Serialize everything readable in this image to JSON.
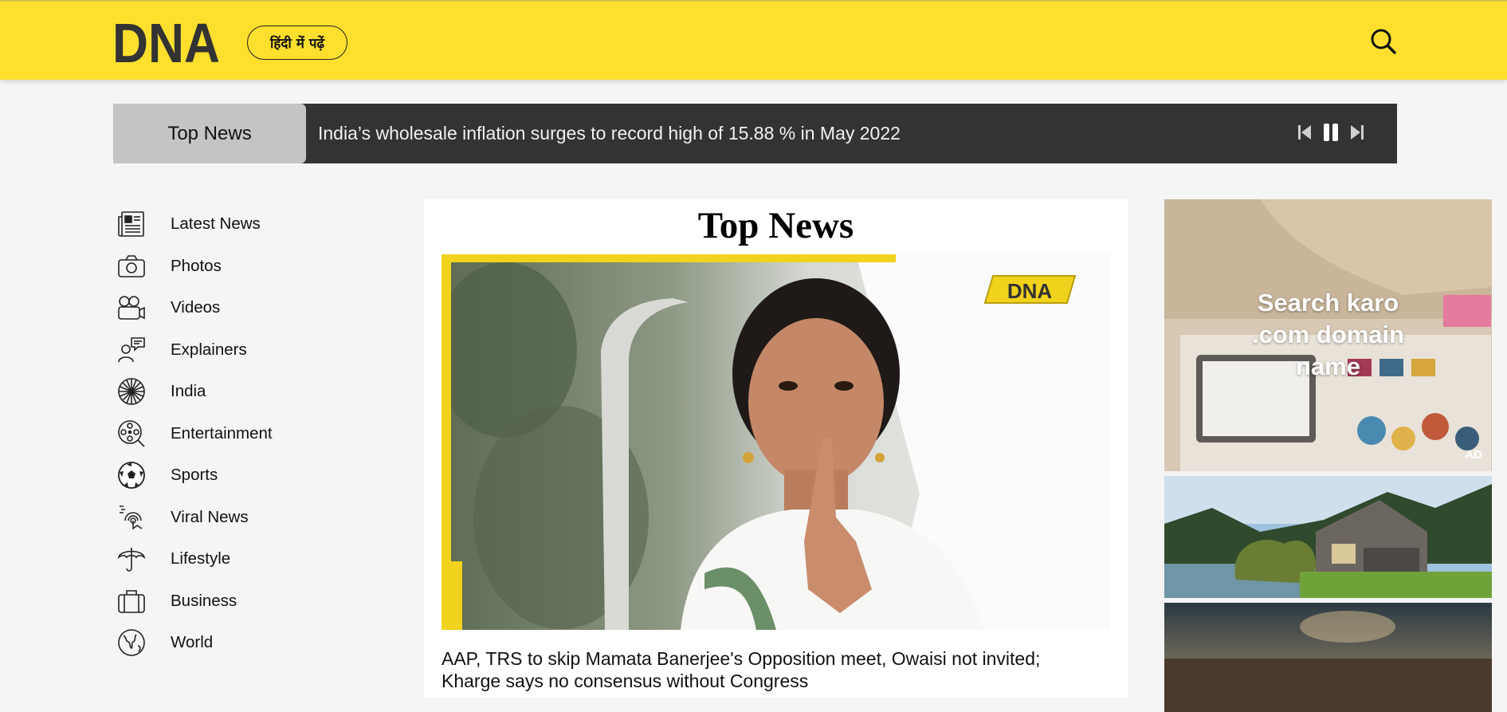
{
  "header": {
    "logo_text": "DNA",
    "language_button": "हिंदी में पढ़ें",
    "search_icon": "search-icon"
  },
  "ticker": {
    "label": "Top News",
    "headline": "India’s wholesale inflation surges to record high of 15.88 % in May 2022",
    "controls": [
      "previous-icon",
      "pause-icon",
      "next-icon"
    ]
  },
  "sidebar": {
    "items": [
      {
        "label": "Latest News",
        "icon": "newspaper-icon"
      },
      {
        "label": "Photos",
        "icon": "camera-icon"
      },
      {
        "label": "Videos",
        "icon": "video-camera-icon"
      },
      {
        "label": "Explainers",
        "icon": "explainer-icon"
      },
      {
        "label": "India",
        "icon": "chakra-icon"
      },
      {
        "label": "Entertainment",
        "icon": "film-reel-icon"
      },
      {
        "label": "Sports",
        "icon": "football-icon"
      },
      {
        "label": "Viral News",
        "icon": "viral-icon"
      },
      {
        "label": "Lifestyle",
        "icon": "umbrella-icon"
      },
      {
        "label": "Business",
        "icon": "briefcase-icon"
      },
      {
        "label": "World",
        "icon": "globe-icon"
      }
    ]
  },
  "main": {
    "title": "Top News",
    "hero_badge": "DNA",
    "headline": "AAP, TRS to skip Mamata Banerjee's Opposition meet, Owaisi not invited; Kharge says no consensus without Congress"
  },
  "ads": {
    "ad1_text_line1": "Search karo",
    "ad1_text_line2": ".com domain",
    "ad1_text_line3": "name",
    "ad1_badge": "AD"
  },
  "colors": {
    "header_bg": "#fedf2e",
    "ticker_bg": "#333333",
    "ticker_label_bg": "#c4c4c4",
    "page_bg": "#f5f5f5"
  }
}
